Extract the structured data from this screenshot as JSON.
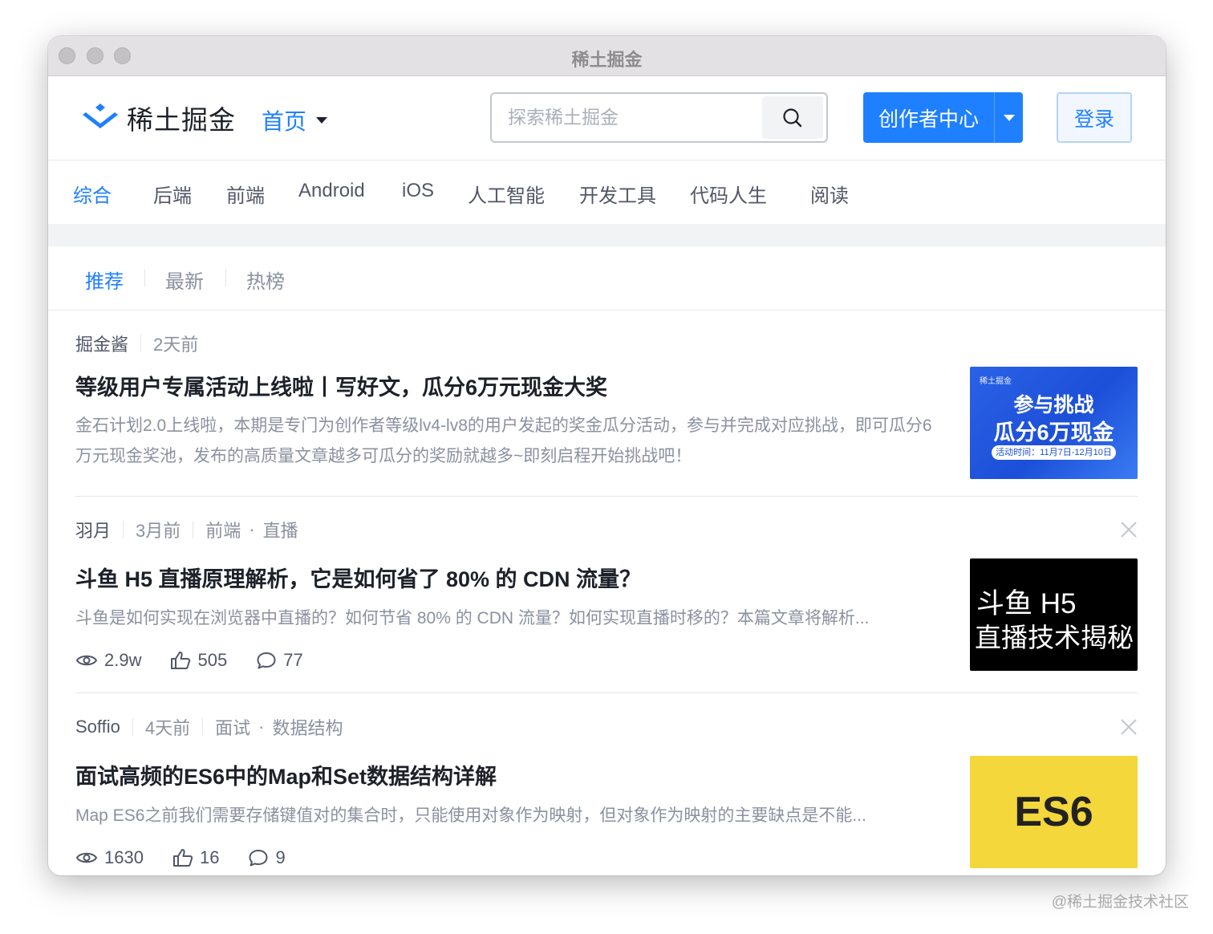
{
  "window": {
    "title": "稀土掘金"
  },
  "header": {
    "logo_text": "稀土掘金",
    "home_label": "首页",
    "search_placeholder": "探索稀土掘金",
    "creator_label": "创作者中心",
    "login_label": "登录",
    "accent_color": "#1e80ff"
  },
  "categories": [
    "综合",
    "后端",
    "前端",
    "Android",
    "iOS",
    "人工智能",
    "开发工具",
    "代码人生",
    "阅读"
  ],
  "active_category": "综合",
  "subtabs": [
    "推荐",
    "最新",
    "热榜"
  ],
  "active_subtab": "推荐",
  "articles": [
    {
      "author": "掘金酱",
      "time": "2天前",
      "title": "等级用户专属活动上线啦丨写好文，瓜分6万元现金大奖",
      "desc": "金石计划2.0上线啦，本期是专门为创作者等级lv4-lv8的用户发起的奖金瓜分活动，参与并完成对应挑战，即可瓜分6万元现金奖池，发布的高质量文章越多可瓜分的奖励就越多~即刻启程开始挑战吧！",
      "thumb": {
        "brand": "稀土掘金",
        "line1": "参与挑战",
        "line2": "瓜分6万现金",
        "line3": "活动时间：11月7日-12月10日"
      }
    },
    {
      "author": "羽月",
      "time": "3月前",
      "tag1": "前端",
      "tag2": "直播",
      "title": "斗鱼 H5 直播原理解析，它是如何省了 80% 的 CDN 流量？",
      "desc": "斗鱼是如何实现在浏览器中直播的？如何节省 80% 的 CDN 流量？如何实现直播时移的？本篇文章将解析...",
      "views": "2.9w",
      "likes": "505",
      "comments": "77",
      "thumb": {
        "line1": "斗鱼 H5",
        "line2": "直播技术揭秘"
      }
    },
    {
      "author": "Soffio",
      "time": "4天前",
      "tag1": "面试",
      "tag2": "数据结构",
      "title": "面试高频的ES6中的Map和Set数据结构详解",
      "desc": "Map ES6之前我们需要存储键值对的集合时，只能使用对象作为映射，但对象作为映射的主要缺点是不能...",
      "views": "1630",
      "likes": "16",
      "comments": "9",
      "thumb": {
        "line1": "ES6"
      }
    }
  ],
  "watermark": "@稀土掘金技术社区"
}
